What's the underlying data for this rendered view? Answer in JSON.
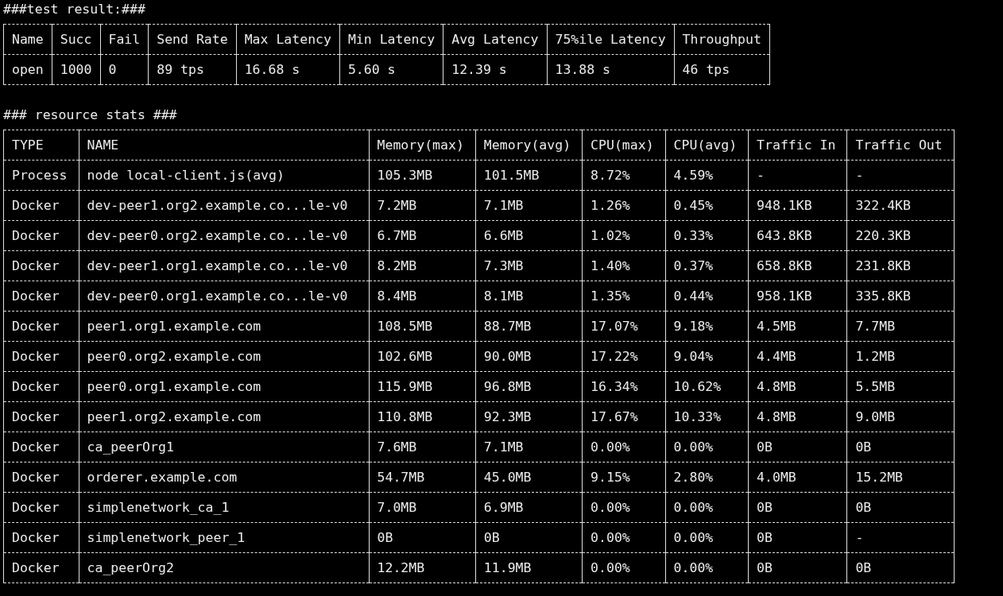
{
  "test_result_heading": "###test result:###",
  "test_result": {
    "columns": [
      "Name",
      "Succ",
      "Fail",
      "Send Rate",
      "Max Latency",
      "Min Latency",
      "Avg Latency",
      "75%ile Latency",
      "Throughput"
    ],
    "rows": [
      [
        "open",
        "1000",
        "0",
        "89 tps",
        "16.68 s",
        "5.60 s",
        "12.39 s",
        "13.88 s",
        "46 tps"
      ]
    ]
  },
  "resource_heading": "### resource stats ###",
  "resource_stats": {
    "columns": [
      "TYPE",
      "NAME",
      "Memory(max)",
      "Memory(avg)",
      "CPU(max)",
      "CPU(avg)",
      "Traffic In",
      "Traffic Out"
    ],
    "rows": [
      [
        "Process",
        "node local-client.js(avg)",
        "105.3MB",
        "101.5MB",
        "8.72%",
        "4.59%",
        "-",
        "-"
      ],
      [
        "Docker",
        "dev-peer1.org2.example.co...le-v0",
        "7.2MB",
        "7.1MB",
        "1.26%",
        "0.45%",
        "948.1KB",
        "322.4KB"
      ],
      [
        "Docker",
        "dev-peer0.org2.example.co...le-v0",
        "6.7MB",
        "6.6MB",
        "1.02%",
        "0.33%",
        "643.8KB",
        "220.3KB"
      ],
      [
        "Docker",
        "dev-peer1.org1.example.co...le-v0",
        "8.2MB",
        "7.3MB",
        "1.40%",
        "0.37%",
        "658.8KB",
        "231.8KB"
      ],
      [
        "Docker",
        "dev-peer0.org1.example.co...le-v0",
        "8.4MB",
        "8.1MB",
        "1.35%",
        "0.44%",
        "958.1KB",
        "335.8KB"
      ],
      [
        "Docker",
        "peer1.org1.example.com",
        "108.5MB",
        "88.7MB",
        "17.07%",
        "9.18%",
        "4.5MB",
        "7.7MB"
      ],
      [
        "Docker",
        "peer0.org2.example.com",
        "102.6MB",
        "90.0MB",
        "17.22%",
        "9.04%",
        "4.4MB",
        "1.2MB"
      ],
      [
        "Docker",
        "peer0.org1.example.com",
        "115.9MB",
        "96.8MB",
        "16.34%",
        "10.62%",
        "4.8MB",
        "5.5MB"
      ],
      [
        "Docker",
        "peer1.org2.example.com",
        "110.8MB",
        "92.3MB",
        "17.67%",
        "10.33%",
        "4.8MB",
        "9.0MB"
      ],
      [
        "Docker",
        "ca_peerOrg1",
        "7.6MB",
        "7.1MB",
        "0.00%",
        "0.00%",
        "0B",
        "0B"
      ],
      [
        "Docker",
        "orderer.example.com",
        "54.7MB",
        "45.0MB",
        "9.15%",
        "2.80%",
        "4.0MB",
        "15.2MB"
      ],
      [
        "Docker",
        "simplenetwork_ca_1",
        "7.0MB",
        "6.9MB",
        "0.00%",
        "0.00%",
        "0B",
        "0B"
      ],
      [
        "Docker",
        "simplenetwork_peer_1",
        "0B",
        "0B",
        "0.00%",
        "0.00%",
        "0B",
        "-"
      ],
      [
        "Docker",
        "ca_peerOrg2",
        "12.2MB",
        "11.9MB",
        "0.00%",
        "0.00%",
        "0B",
        "0B"
      ]
    ]
  }
}
